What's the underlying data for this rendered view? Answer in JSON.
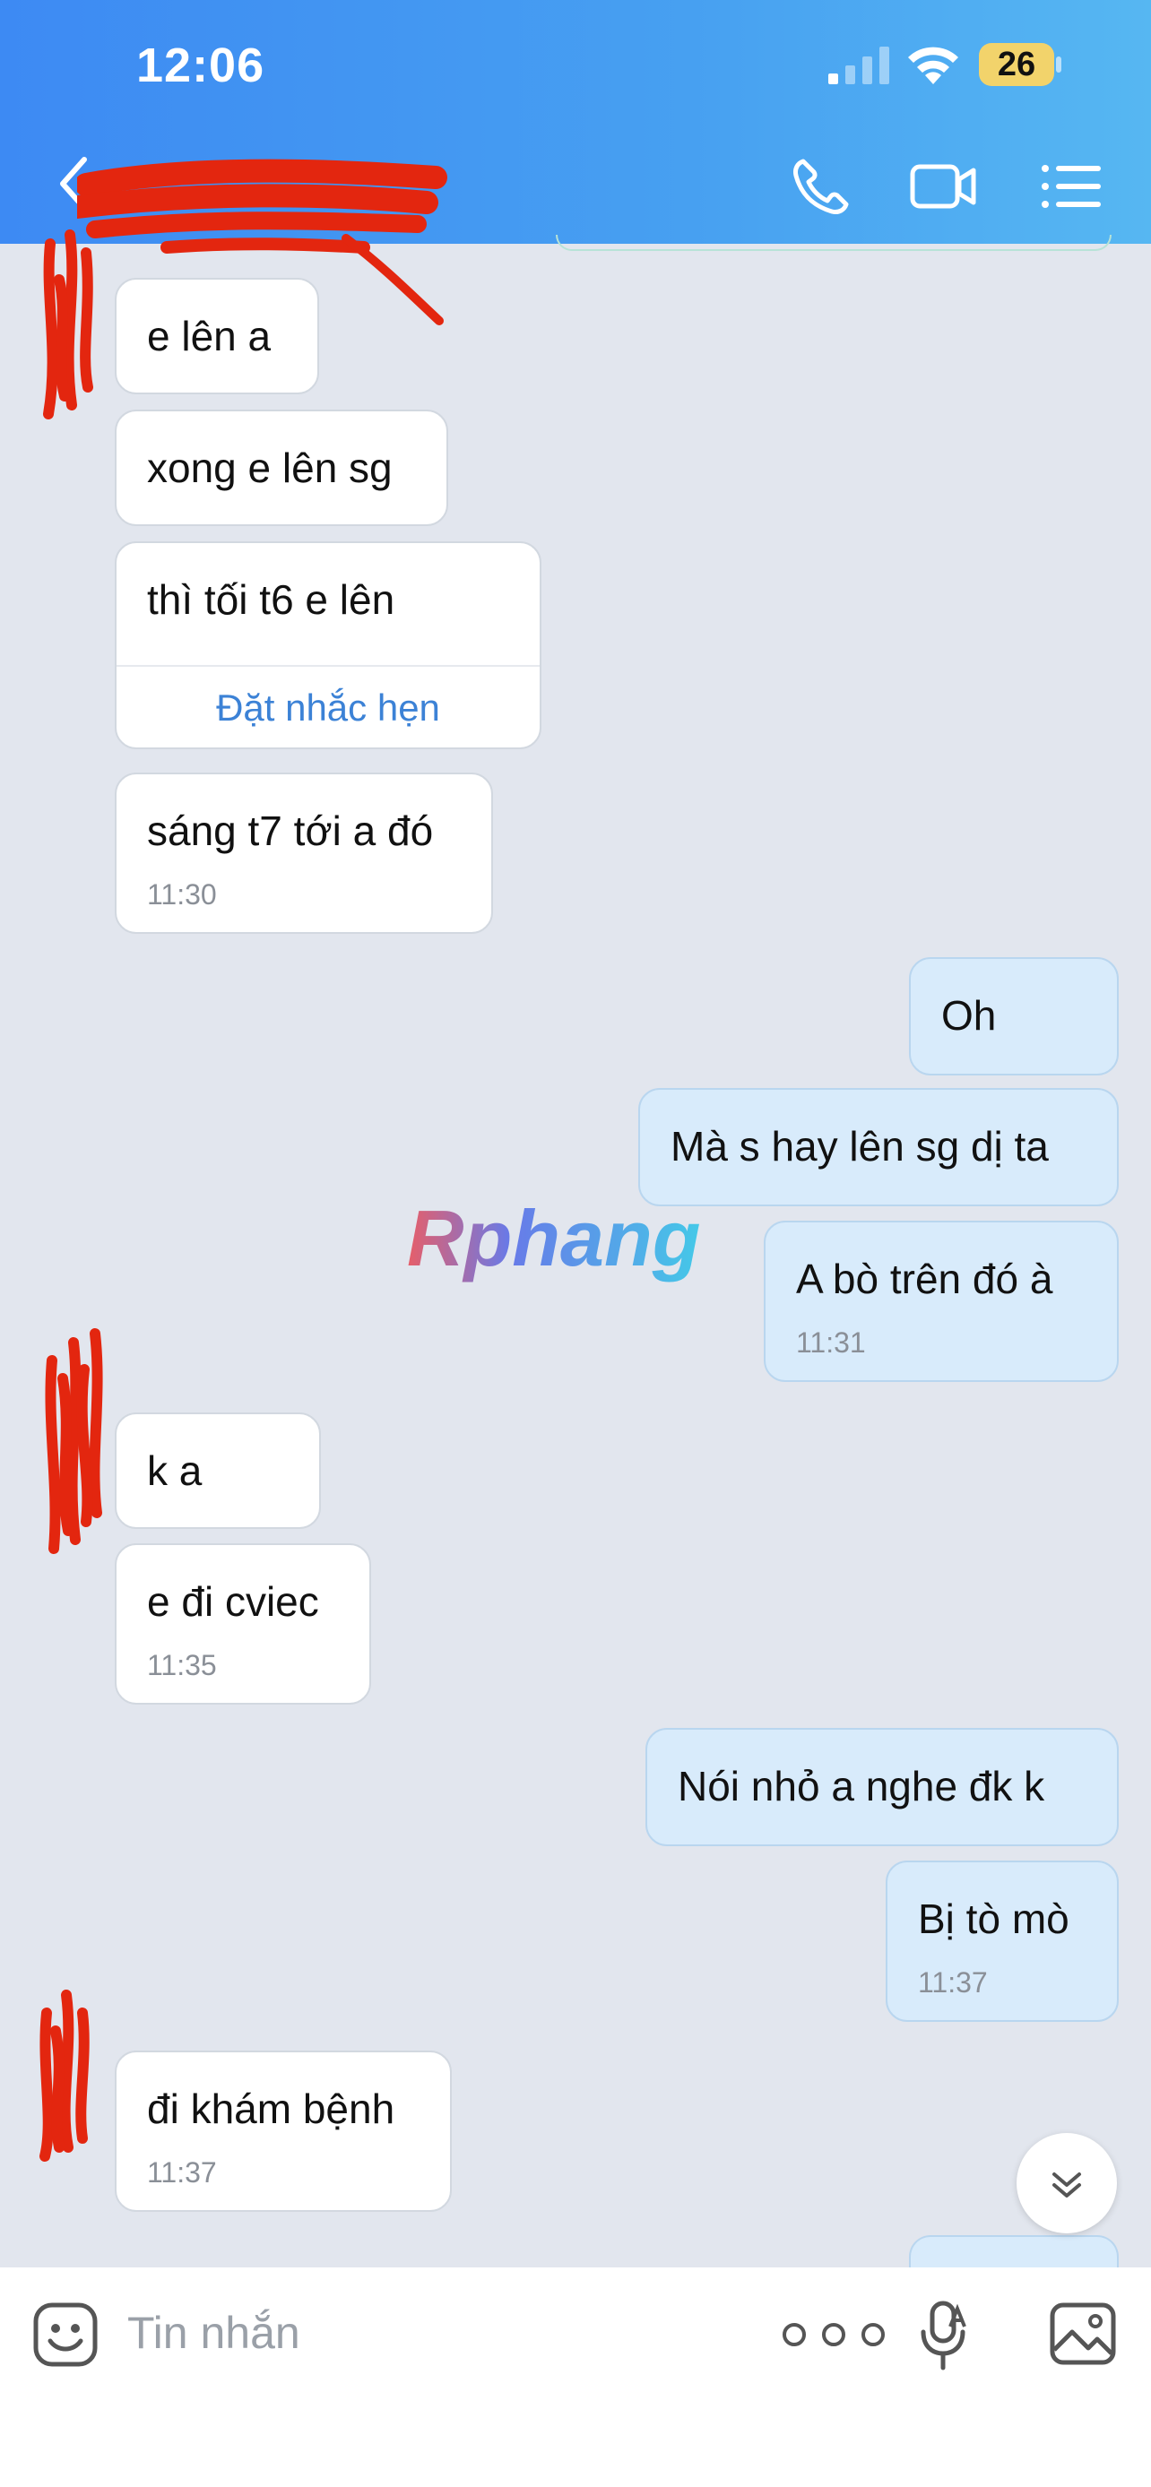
{
  "status_bar": {
    "time": "12:06",
    "battery": "26"
  },
  "header": {
    "icons": [
      "back-icon",
      "phone-icon",
      "video-call-icon",
      "menu-list-icon"
    ]
  },
  "watermark": "Rphang",
  "messages": [
    {
      "dir": "in",
      "text": "e lên a"
    },
    {
      "dir": "in",
      "text": "xong e lên sg"
    },
    {
      "dir": "in",
      "text": "thì tối t6 e lên",
      "action": "Đặt nhắc hẹn"
    },
    {
      "dir": "in",
      "text": "sáng t7 tới a đó",
      "time": "11:30"
    },
    {
      "dir": "out",
      "text": "Oh"
    },
    {
      "dir": "out",
      "text": "Mà s hay lên sg dị ta"
    },
    {
      "dir": "out",
      "text": "A bò trên đó à",
      "time": "11:31"
    },
    {
      "dir": "in",
      "text": "k a"
    },
    {
      "dir": "in",
      "text": "e đi cviec",
      "time": "11:35"
    },
    {
      "dir": "out",
      "text": "Nói nhỏ a nghe đk k"
    },
    {
      "dir": "out",
      "text": "Bị tò mò",
      "time": "11:37"
    },
    {
      "dir": "in",
      "text": "đi khám bệnh",
      "time": "11:37"
    }
  ],
  "composer": {
    "placeholder": "Tin nhắn"
  },
  "colors": {
    "header_start": "#3d8af3",
    "header_end": "#56b7f2",
    "outgoing_bubble": "#d8ebfb",
    "incoming_bubble": "#ffffff",
    "link": "#3c82d6",
    "redaction": "#e3260f"
  }
}
